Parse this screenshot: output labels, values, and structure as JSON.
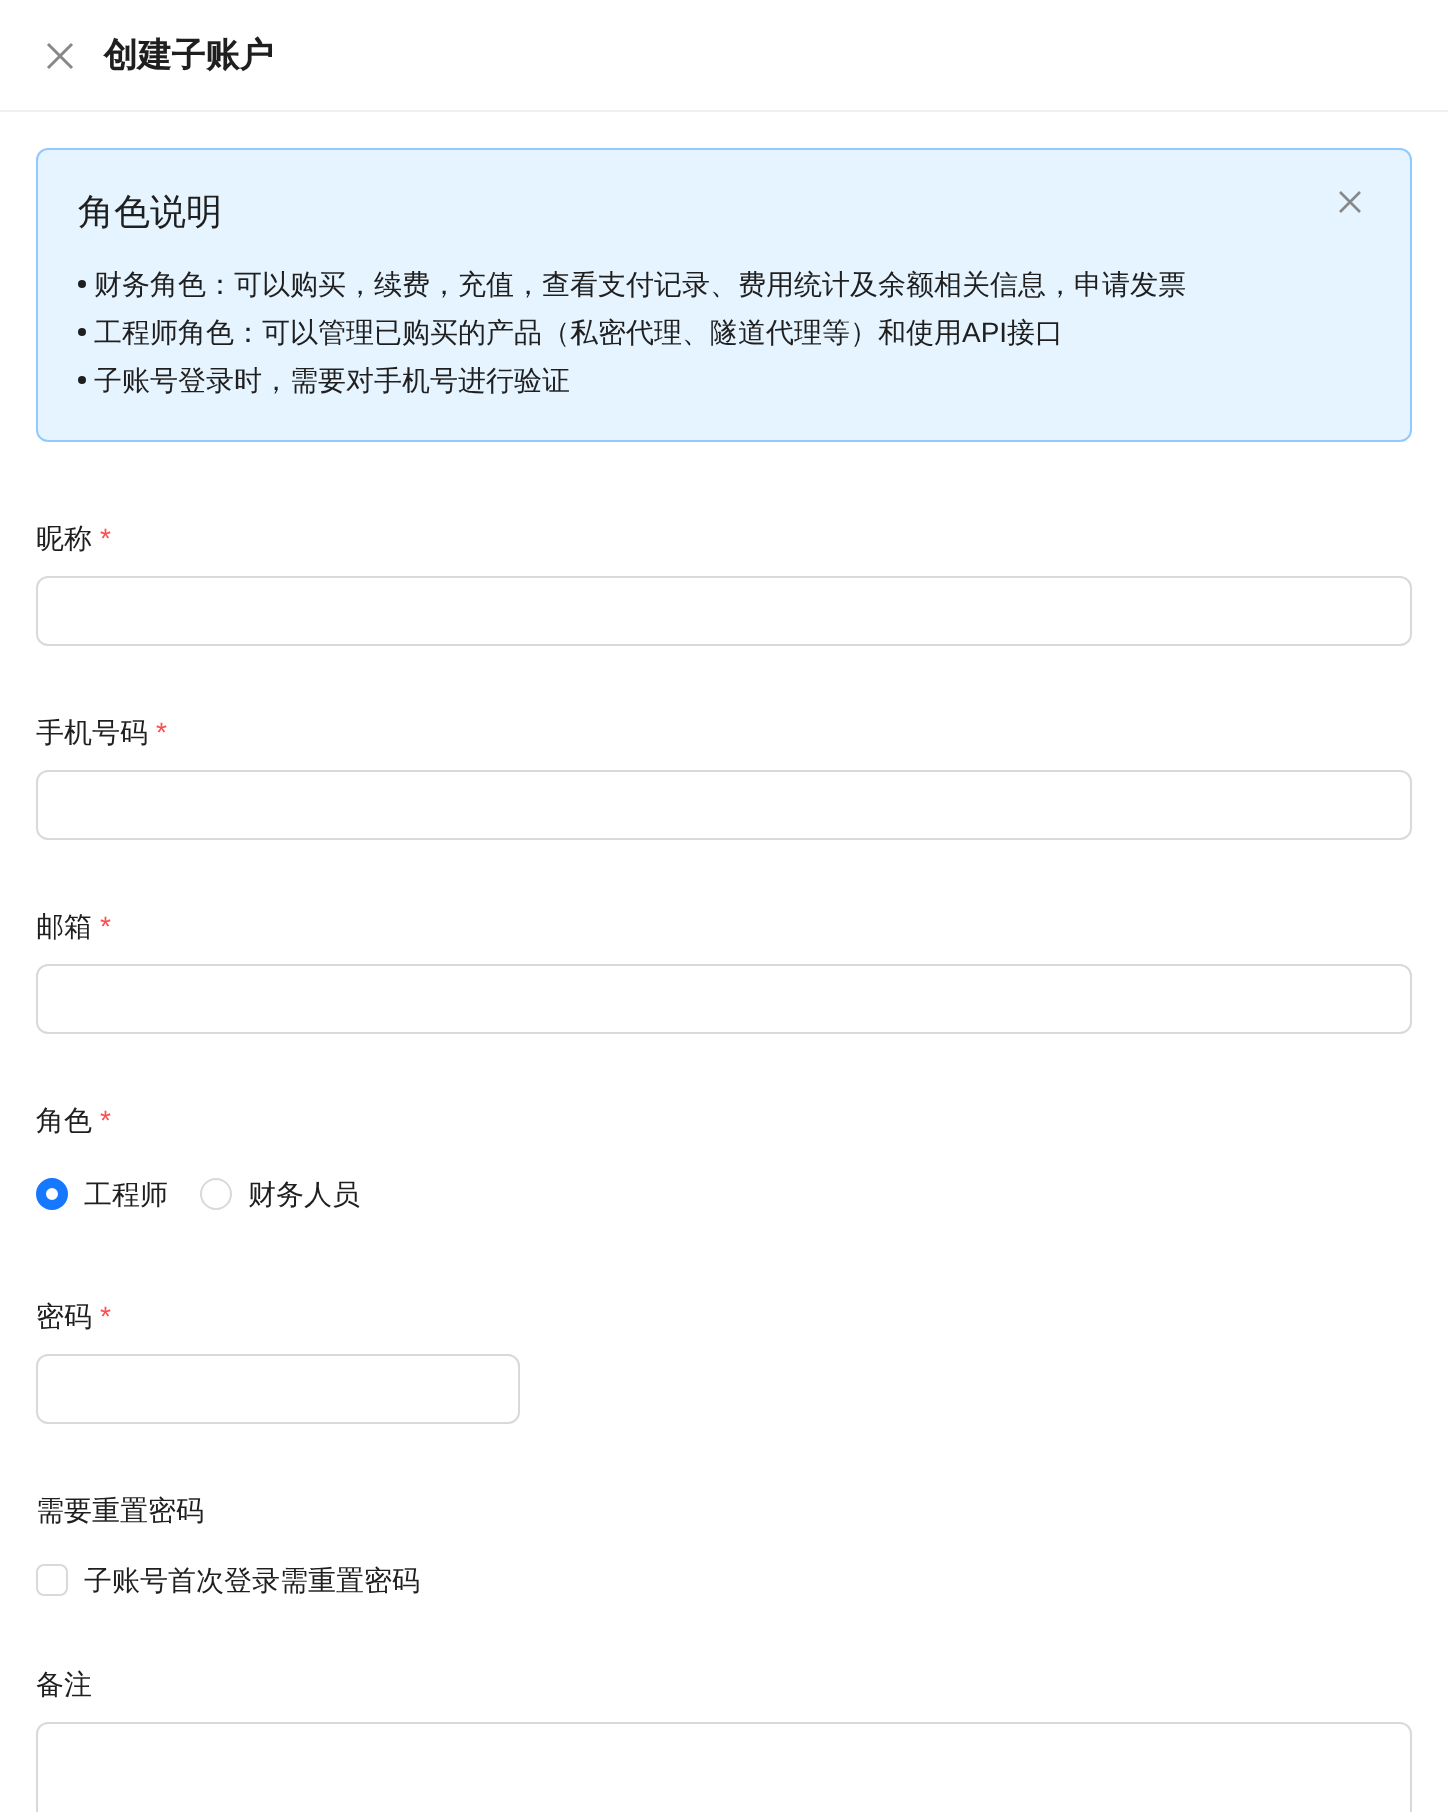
{
  "header": {
    "title": "创建子账户"
  },
  "notice": {
    "title": "角色说明",
    "items": [
      "财务角色：可以购买，续费，充值，查看支付记录、费用统计及余额相关信息，申请发票",
      "工程师角色：可以管理已购买的产品（私密代理、隧道代理等）和使用API接口",
      "子账号登录时，需要对手机号进行验证"
    ]
  },
  "fields": [
    {
      "kind": "text",
      "label": "昵称",
      "required_mark": "*"
    },
    {
      "kind": "text",
      "label": "手机号码",
      "required_mark": "*"
    },
    {
      "kind": "text",
      "label": "邮箱",
      "required_mark": "*"
    },
    {
      "kind": "radio",
      "label": "角色",
      "required_mark": "*",
      "options": [
        {
          "label": "工程师",
          "selected": true
        },
        {
          "label": "财务人员",
          "selected": false
        }
      ]
    },
    {
      "kind": "password",
      "label": "密码",
      "required_mark": "*"
    },
    {
      "kind": "checkbox",
      "label": "需要重置密码",
      "option": {
        "label": "子账号首次登录需重置密码",
        "checked": false
      }
    },
    {
      "kind": "textarea",
      "label": "备注"
    }
  ]
}
